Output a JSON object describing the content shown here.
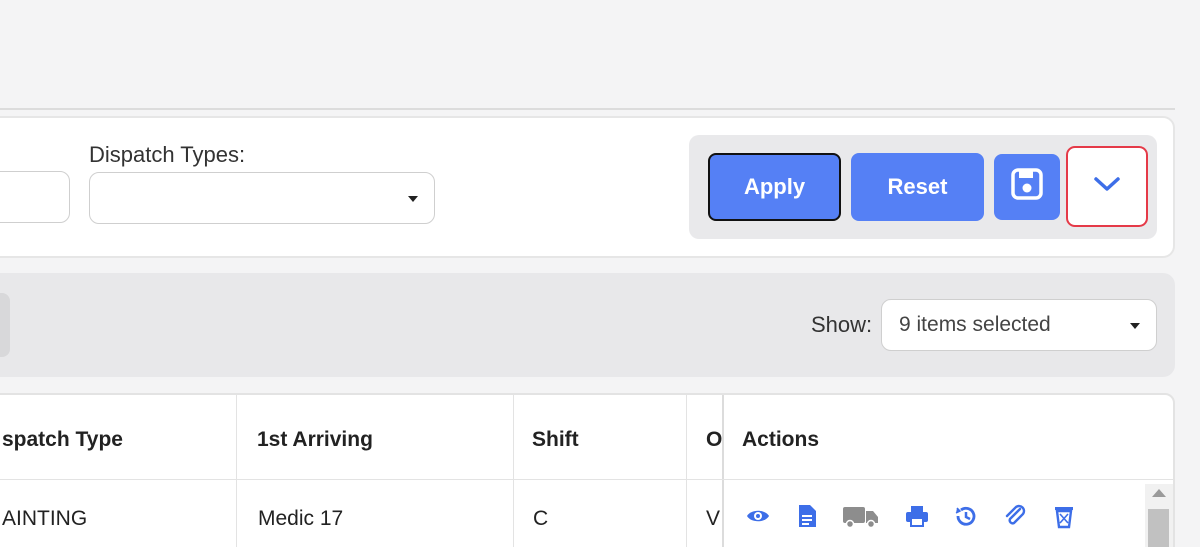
{
  "filters": {
    "dispatch_types_label": "Dispatch Types:",
    "dispatch_types_value": ""
  },
  "buttons": {
    "apply": "Apply",
    "reset": "Reset",
    "save_icon": "save-icon",
    "toggle_icon": "chevron-down-icon"
  },
  "toolbar": {
    "show_label": "Show:",
    "show_value": "9 items selected"
  },
  "table": {
    "headers": [
      "spatch Type",
      "1st Arriving",
      "Shift",
      "O",
      "Actions"
    ],
    "rows": [
      [
        "AINTING",
        "Medic 17",
        "C",
        "V"
      ]
    ],
    "action_icons": [
      "view-icon",
      "report-icon",
      "truck-icon",
      "print-icon",
      "history-icon",
      "attachment-icon",
      "delete-icon"
    ]
  },
  "colors": {
    "accent": "#5580f5",
    "focus_border": "#e53a48",
    "action_icon": "#3d6ee8"
  }
}
